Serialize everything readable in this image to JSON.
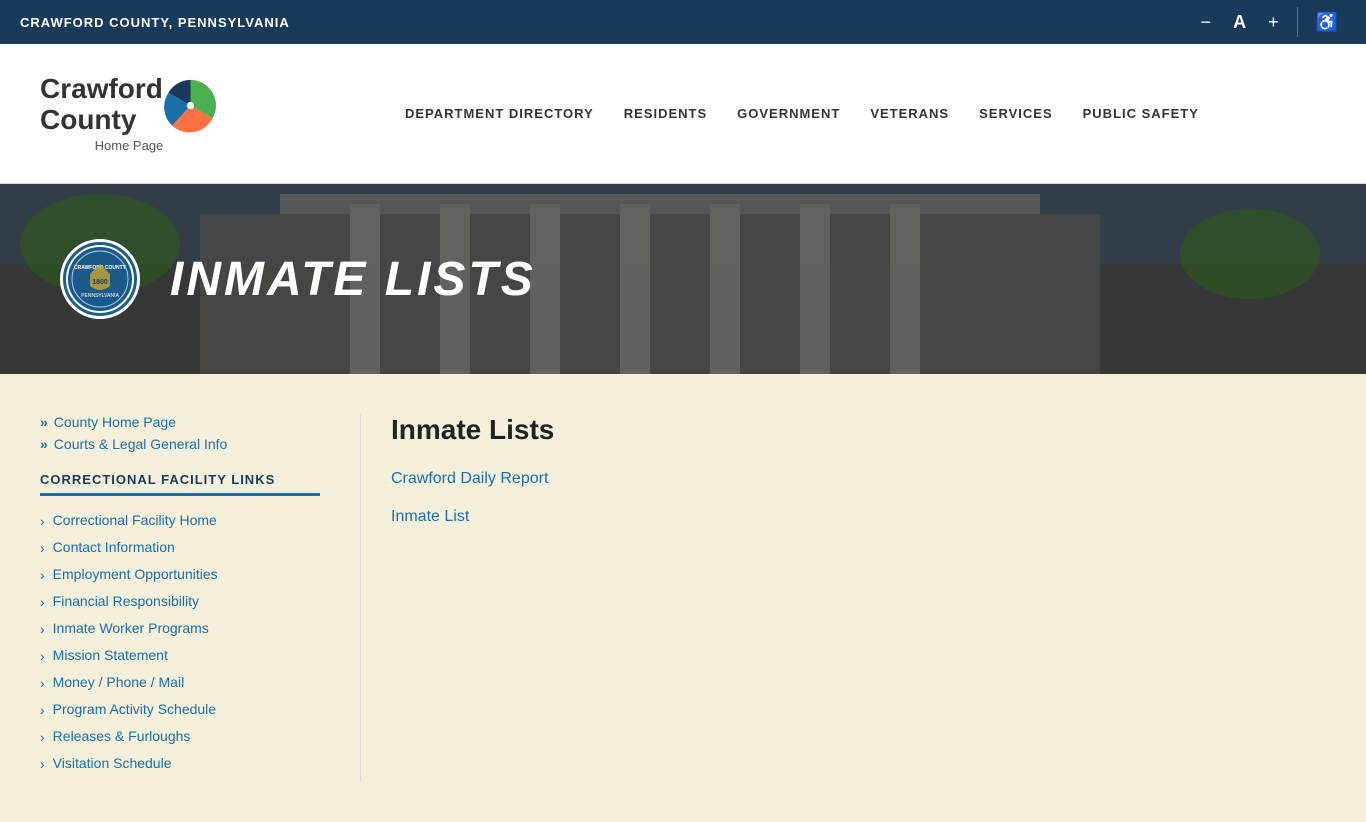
{
  "topbar": {
    "county_name": "CRAWFORD COUNTY, PENNSYLVANIA",
    "tools": {
      "decrease_font": "−",
      "font_label": "A",
      "increase_font": "+",
      "accessibility": "♿"
    }
  },
  "header": {
    "logo_text_line1": "Crawford",
    "logo_text_line2": "County",
    "logo_subtitle": "Home Page",
    "nav": [
      {
        "label": "DEPARTMENT DIRECTORY",
        "id": "dept-dir"
      },
      {
        "label": "RESIDENTS",
        "id": "residents"
      },
      {
        "label": "GOVERNMENT",
        "id": "government"
      },
      {
        "label": "VETERANS",
        "id": "veterans"
      },
      {
        "label": "SERVICES",
        "id": "services"
      },
      {
        "label": "PUBLIC SAFETY",
        "id": "public-safety"
      }
    ]
  },
  "hero": {
    "title": "INMATE LISTS"
  },
  "sidebar": {
    "breadcrumbs": [
      {
        "label": "County Home Page",
        "href": "#"
      },
      {
        "label": "Courts & Legal General Info",
        "href": "#"
      }
    ],
    "section_title": "CORRECTIONAL FACILITY LINKS",
    "links": [
      {
        "label": "Correctional Facility Home"
      },
      {
        "label": "Contact Information"
      },
      {
        "label": "Employment Opportunities"
      },
      {
        "label": "Financial Responsibility"
      },
      {
        "label": "Inmate Worker Programs"
      },
      {
        "label": "Mission Statement"
      },
      {
        "label": "Money / Phone / Mail"
      },
      {
        "label": "Program Activity Schedule"
      },
      {
        "label": "Releases & Furloughs"
      },
      {
        "label": "Visitation Schedule"
      }
    ]
  },
  "main": {
    "title": "Inmate Lists",
    "links": [
      {
        "label": "Crawford Daily Report"
      },
      {
        "label": "Inmate List"
      }
    ]
  }
}
